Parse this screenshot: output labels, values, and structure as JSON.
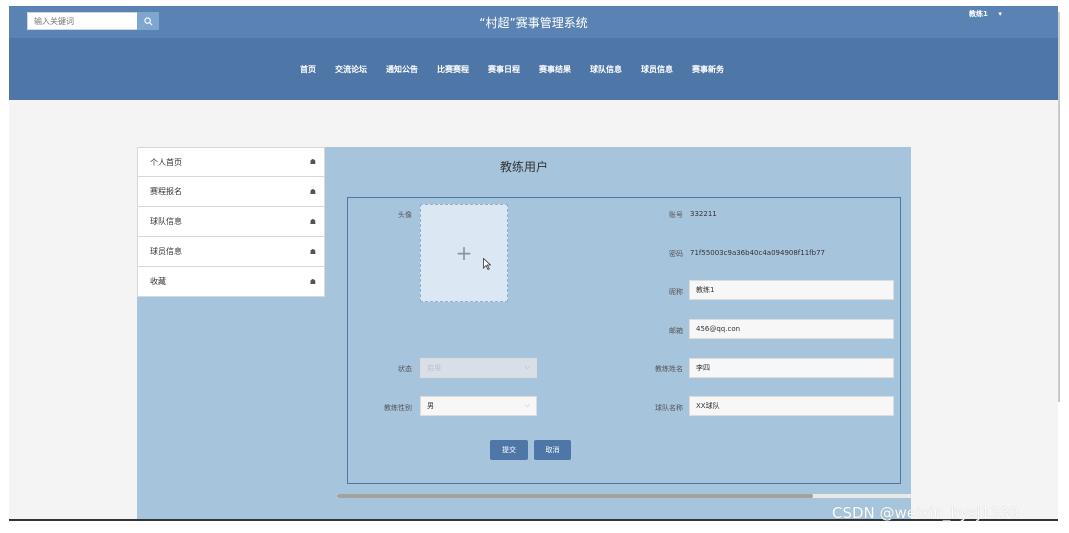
{
  "header": {
    "search_placeholder": "输入关键词",
    "site_title": "“村超”赛事管理系统",
    "user_label": "教练1",
    "user_caret": "▾"
  },
  "nav": {
    "items": [
      "首页",
      "交流论坛",
      "通知公告",
      "比赛赛程",
      "赛事日程",
      "赛事结果",
      "球队信息",
      "球员信息",
      "赛事新务"
    ]
  },
  "sidebar": {
    "items": [
      {
        "label": "个人首页",
        "icon": "☗"
      },
      {
        "label": "赛程报名",
        "icon": "☗"
      },
      {
        "label": "球队信息",
        "icon": "☗"
      },
      {
        "label": "球员信息",
        "icon": "☗"
      },
      {
        "label": "收藏",
        "icon": "☗"
      }
    ]
  },
  "panel": {
    "title": "教练用户"
  },
  "form": {
    "avatar_label": "头像",
    "avatar_plus": "+",
    "account_label": "账号",
    "account_value": "332211",
    "password_label": "密码",
    "password_value": "71f55003c9a36b40c4a094908f11fb77",
    "nickname_label": "昵称",
    "nickname_value": "教练1",
    "email_label": "邮箱",
    "email_value": "456@qq.con",
    "status_label": "状态",
    "status_value": "启用",
    "coach_name_label": "教练姓名",
    "coach_name_value": "李四",
    "gender_label": "教练性别",
    "gender_value": "男",
    "team_name_label": "球队名称",
    "team_name_value": "XX球队",
    "submit_label": "提交",
    "cancel_label": "取消"
  },
  "watermark": "CSDN @weixin_bysj1330",
  "colors": {
    "header": "#4e77a8",
    "content": "#a7c4dd",
    "button": "#4e77a8"
  }
}
